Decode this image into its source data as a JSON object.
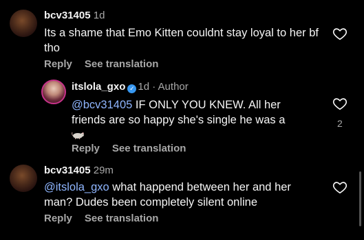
{
  "comments": [
    {
      "username": "bcv31405",
      "time": "1d",
      "text": "Its a shame that Emo Kitten  couldnt stay loyal to her bf tho",
      "reply_label": "Reply",
      "translate_label": "See translation"
    },
    {
      "username": "itslola_gxo",
      "time": "1d",
      "author_tag": "· Author",
      "mention": "@bcv31405",
      "text": " IF ONLY YOU KNEW. All her friends are so happy she's single he was a",
      "emoji": "rat-emoji",
      "like_count": "2",
      "reply_label": "Reply",
      "translate_label": "See translation"
    },
    {
      "username": "bcv31405",
      "time": "29m",
      "mention": "@itslola_gxo",
      "text": " what happend between her and her man? Dudes been completely silent online",
      "reply_label": "Reply",
      "translate_label": "See translation"
    }
  ],
  "icons": {
    "like": "heart-outline-icon",
    "verified": "verified-badge-icon"
  },
  "colors": {
    "background": "#000000",
    "mention": "#8fb6ff",
    "secondary_text": "#a8a8a8",
    "verified": "#3797f0"
  }
}
